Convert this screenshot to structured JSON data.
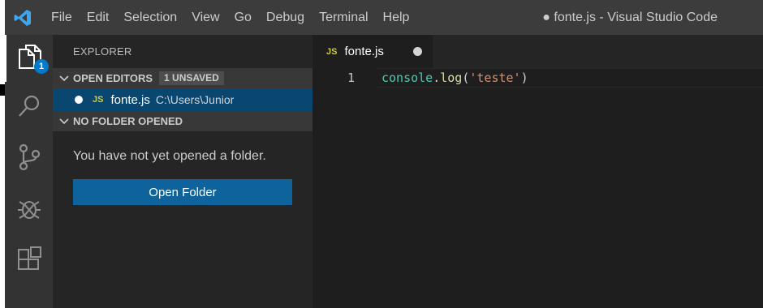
{
  "titlebar": {
    "menu": [
      "File",
      "Edit",
      "Selection",
      "View",
      "Go",
      "Debug",
      "Terminal",
      "Help"
    ],
    "window_title": "● fonte.js - Visual Studio Code"
  },
  "activity_bar": {
    "explorer_badge": "1",
    "icons": [
      "files-icon",
      "search-icon",
      "source-control-icon",
      "debug-icon",
      "extensions-icon"
    ]
  },
  "sidebar": {
    "title": "EXPLORER",
    "open_editors": {
      "header": "OPEN EDITORS",
      "badge": "1 UNSAVED",
      "files": [
        {
          "icon": "JS",
          "name": "fonte.js",
          "path": "C:\\Users\\Junior"
        }
      ]
    },
    "no_folder": {
      "header": "NO FOLDER OPENED",
      "message": "You have not yet opened a folder.",
      "button": "Open Folder"
    }
  },
  "editor": {
    "tab": {
      "icon": "JS",
      "name": "fonte.js"
    },
    "lines": [
      {
        "number": "1",
        "obj": "console",
        "dot": ".",
        "fn": "log",
        "open": "(",
        "str": "'teste'",
        "close": ")"
      }
    ]
  },
  "colors": {
    "accent": "#007acc",
    "button": "#0e639c",
    "selection": "#094771",
    "js_icon": "#cbcb41"
  }
}
